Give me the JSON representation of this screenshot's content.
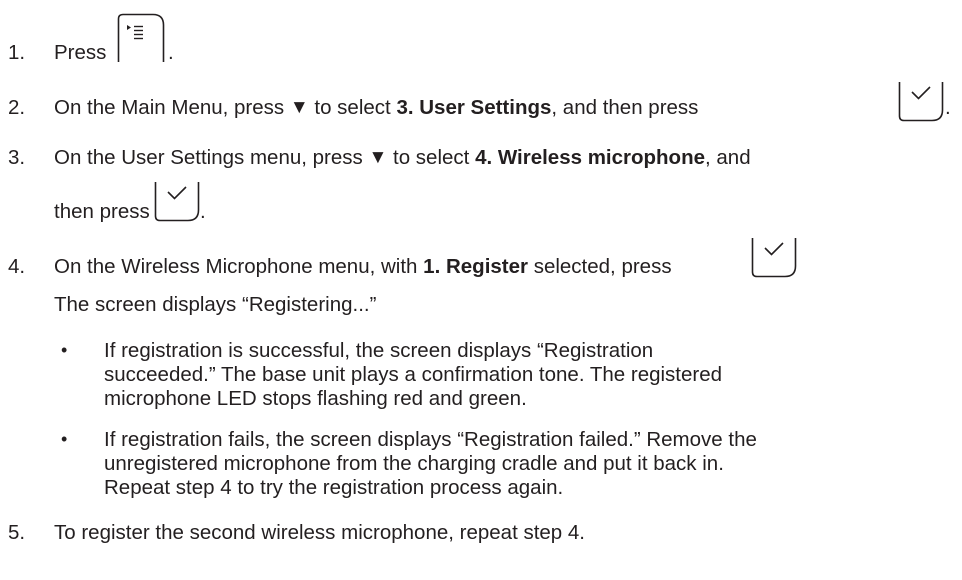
{
  "steps": [
    {
      "num": "1.",
      "press": "Press",
      "after_icon": "."
    },
    {
      "num": "2.",
      "text_a": "On the Main Menu, press",
      "arrow": "▼",
      "text_b": "to select",
      "bold": "3. User Settings",
      "text_c": ", and then press",
      "after_icon": "."
    },
    {
      "num": "3.",
      "text_a": "On the User Settings menu, press",
      "arrow": "▼",
      "text_b": "to select",
      "bold": "4. Wireless microphone",
      "text_c": ", and",
      "line2": "then press",
      "after_icon": "."
    },
    {
      "num": "4.",
      "text_a": "On the Wireless Microphone menu, with",
      "bold": "1. Register",
      "text_b": "selected, press",
      "sub": "The screen displays “Registering...”",
      "bullets": [
        {
          "symbol": "•",
          "lines": [
            "If registration is successful, the screen displays “Registration",
            "succeeded.” The base unit plays a confirmation tone. The registered",
            "microphone LED stops flashing red and green."
          ]
        },
        {
          "symbol": "•",
          "lines": [
            "If registration fails, the screen displays “Registration failed.” Remove the",
            "unregistered microphone from the charging cradle and put it back in.",
            "Repeat step 4 to try the registration process again."
          ]
        }
      ]
    },
    {
      "num": "5.",
      "text": "To register the second wireless microphone, repeat step 4."
    }
  ],
  "icons": {
    "menu": "menu-key-icon",
    "ok": "checkmark-key-icon"
  }
}
